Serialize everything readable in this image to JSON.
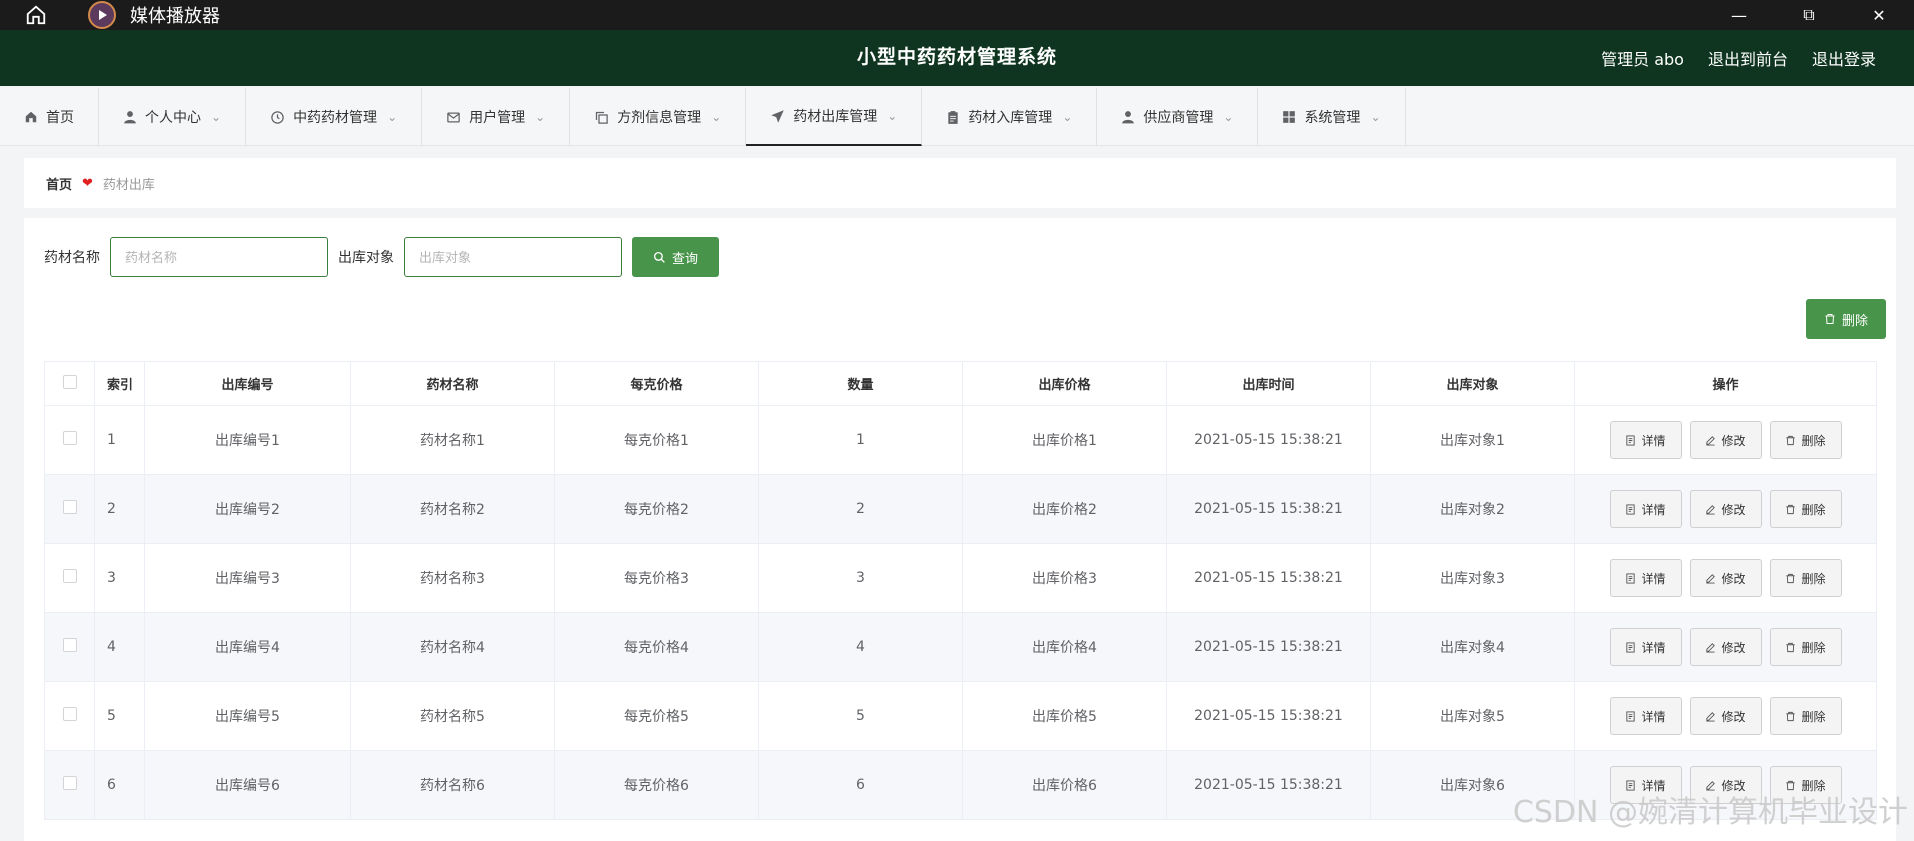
{
  "player": {
    "title": "媒体播放器",
    "minimize": "—",
    "restore": "⧉",
    "close": "✕"
  },
  "header": {
    "title": "小型中药药材管理系统",
    "user": "管理员 abo",
    "to_front": "退出到前台",
    "logout": "退出登录"
  },
  "nav": {
    "items": [
      {
        "label": "首页",
        "icon": "home-icon"
      },
      {
        "label": "个人中心",
        "icon": "user-icon"
      },
      {
        "label": "中药药材管理",
        "icon": "clock-icon"
      },
      {
        "label": "用户管理",
        "icon": "mail-icon"
      },
      {
        "label": "方剂信息管理",
        "icon": "copy-icon"
      },
      {
        "label": "药材出库管理",
        "icon": "send-icon"
      },
      {
        "label": "药材入库管理",
        "icon": "clipboard-icon"
      },
      {
        "label": "供应商管理",
        "icon": "person-icon"
      },
      {
        "label": "系统管理",
        "icon": "grid-icon"
      }
    ],
    "active_index": 5
  },
  "breadcrumb": {
    "home": "首页",
    "current": "药材出库"
  },
  "search": {
    "name_label": "药材名称",
    "name_placeholder": "药材名称",
    "target_label": "出库对象",
    "target_placeholder": "出库对象",
    "query_label": "查询"
  },
  "toolbar": {
    "delete_label": "删除"
  },
  "table": {
    "columns": [
      "索引",
      "出库编号",
      "药材名称",
      "每克价格",
      "数量",
      "出库价格",
      "出库时间",
      "出库对象",
      "操作"
    ],
    "rows": [
      {
        "idx": "1",
        "code": "出库编号1",
        "name": "药材名称1",
        "unit_price": "每克价格1",
        "qty": "1",
        "price": "出库价格1",
        "time": "2021-05-15 15:38:21",
        "target": "出库对象1"
      },
      {
        "idx": "2",
        "code": "出库编号2",
        "name": "药材名称2",
        "unit_price": "每克价格2",
        "qty": "2",
        "price": "出库价格2",
        "time": "2021-05-15 15:38:21",
        "target": "出库对象2"
      },
      {
        "idx": "3",
        "code": "出库编号3",
        "name": "药材名称3",
        "unit_price": "每克价格3",
        "qty": "3",
        "price": "出库价格3",
        "time": "2021-05-15 15:38:21",
        "target": "出库对象3"
      },
      {
        "idx": "4",
        "code": "出库编号4",
        "name": "药材名称4",
        "unit_price": "每克价格4",
        "qty": "4",
        "price": "出库价格4",
        "time": "2021-05-15 15:38:21",
        "target": "出库对象4"
      },
      {
        "idx": "5",
        "code": "出库编号5",
        "name": "药材名称5",
        "unit_price": "每克价格5",
        "qty": "5",
        "price": "出库价格5",
        "time": "2021-05-15 15:38:21",
        "target": "出库对象5"
      },
      {
        "idx": "6",
        "code": "出库编号6",
        "name": "药材名称6",
        "unit_price": "每克价格6",
        "qty": "6",
        "price": "出库价格6",
        "time": "2021-05-15 15:38:21",
        "target": "出库对象6"
      }
    ],
    "actions": {
      "detail": "详情",
      "edit": "修改",
      "delete": "删除"
    }
  },
  "watermark": "CSDN @婉清计算机毕业设计",
  "colors": {
    "header_bg": "#0f3520",
    "accent_green": "#48944a",
    "player_bg": "#1b1b1b"
  }
}
